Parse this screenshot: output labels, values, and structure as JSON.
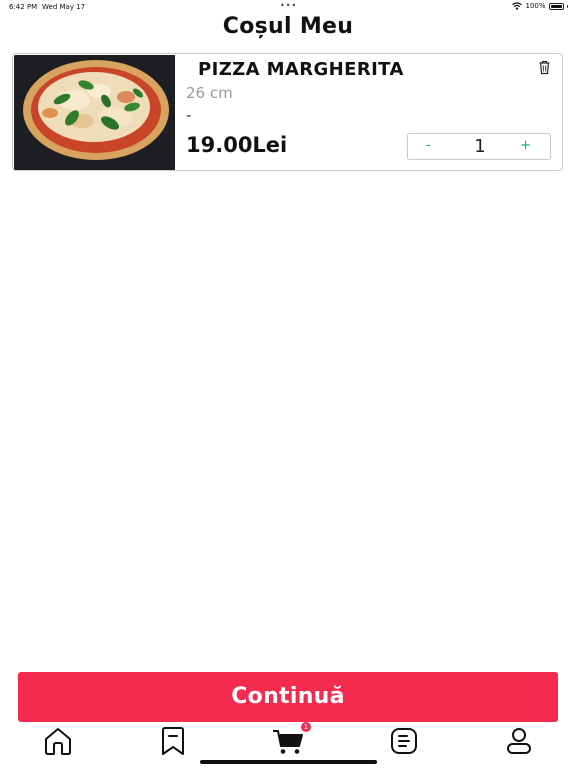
{
  "status_bar": {
    "time": "6:42 PM",
    "date": "Wed May 17",
    "battery": "100%"
  },
  "page": {
    "title": "Coșul Meu"
  },
  "cart": {
    "items": [
      {
        "name": "PIZZA MARGHERITA",
        "size": "26 cm",
        "extras": "-",
        "price": "19.00Lei",
        "quantity": "1",
        "minus_label": "-",
        "plus_label": "+"
      }
    ]
  },
  "actions": {
    "continue_label": "Continuă"
  },
  "tab_bar": {
    "tabs": [
      {
        "icon": "home-icon"
      },
      {
        "icon": "bookmark-icon"
      },
      {
        "icon": "cart-icon",
        "active": true
      },
      {
        "icon": "orders-icon"
      },
      {
        "icon": "profile-icon"
      }
    ],
    "cart_badge": "1"
  },
  "colors": {
    "accent": "#f42b4e",
    "stepper": "#18a58a",
    "muted": "#9a9a9a"
  }
}
